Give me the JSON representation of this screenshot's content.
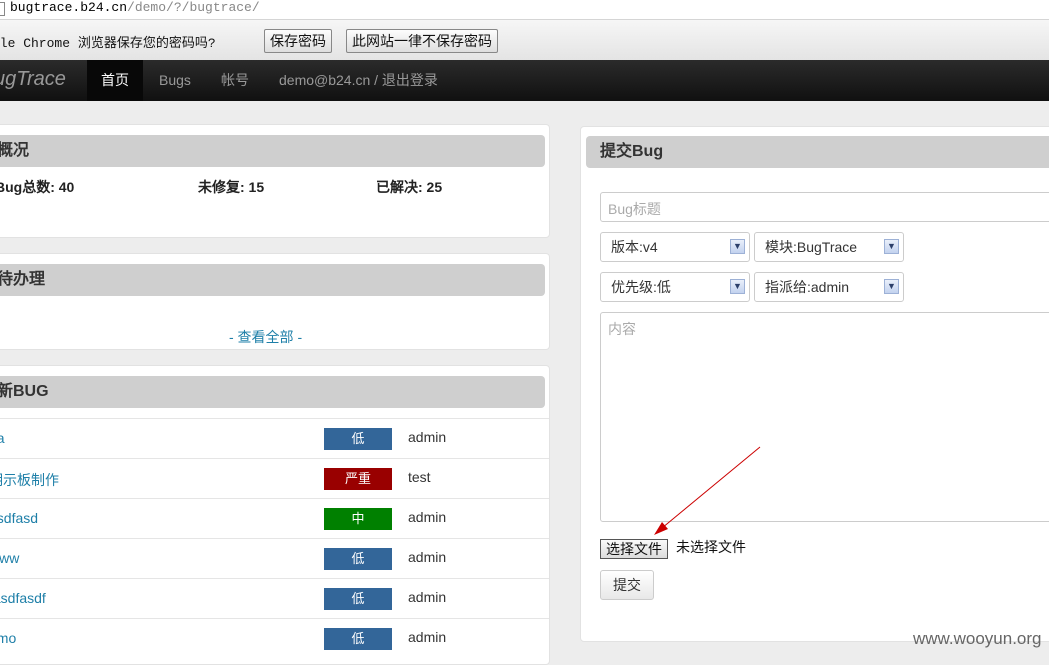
{
  "browser": {
    "url_host": "bugtrace.b24.cn",
    "url_path": "/demo/?/bugtrace/"
  },
  "infobar": {
    "message": "gle Chrome 浏览器保存您的密码吗?",
    "save_label": "保存密码",
    "never_label": "此网站一律不保存密码"
  },
  "nav": {
    "brand": "ugTrace",
    "items": [
      "首页",
      "Bugs",
      "帐号"
    ],
    "user": "demo@b24.cn / 退出登录"
  },
  "overview": {
    "title": "概况",
    "total_label": "Bug总数: 40",
    "unfixed_label": "未修复: 15",
    "resolved_label": "已解决: 25"
  },
  "todo": {
    "title": "待办理",
    "view_all": "- 查看全部 -"
  },
  "latest": {
    "title": "新BUG",
    "rows": [
      {
        "title": "aa",
        "priority": "低",
        "priority_color": "#336699",
        "owner": "admin"
      },
      {
        "title": "明示板制作",
        "priority": "严重",
        "priority_color": "#990000",
        "owner": "test"
      },
      {
        "title": "asdfasd",
        "priority": "中",
        "priority_color": "#008000",
        "owner": "admin"
      },
      {
        "title": "www",
        "priority": "低",
        "priority_color": "#336699",
        "owner": "admin"
      },
      {
        "title": "fasdfasdf",
        "priority": "低",
        "priority_color": "#336699",
        "owner": "admin"
      },
      {
        "title": "emo",
        "priority": "低",
        "priority_color": "#336699",
        "owner": "admin"
      }
    ]
  },
  "submit_form": {
    "title": "提交Bug",
    "title_placeholder": "Bug标题",
    "version": "版本:v4",
    "module": "模块:BugTrace",
    "priority": "优先级:低",
    "assignee": "指派给:admin",
    "content_placeholder": "内容",
    "file_button": "选择文件",
    "file_status": "未选择文件",
    "submit_label": "提交"
  },
  "watermark": "www.wooyun.org",
  "colors": {
    "annotation_arrow": "#cc0000",
    "link": "#1e7fa8"
  }
}
